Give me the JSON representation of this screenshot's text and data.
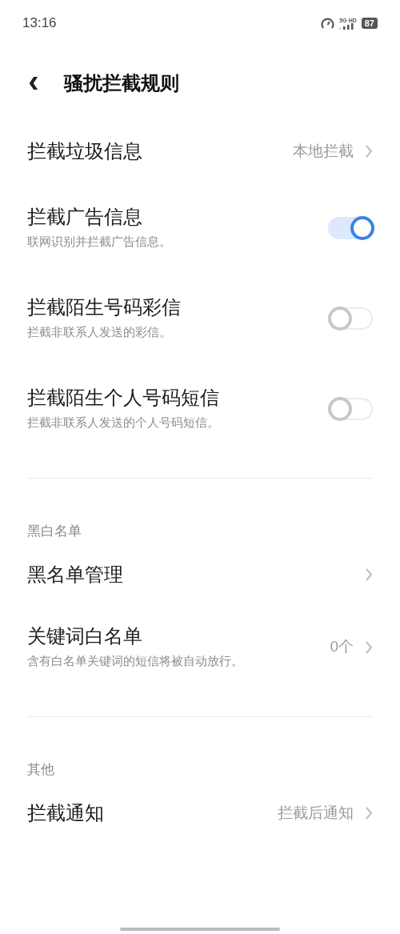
{
  "status_bar": {
    "time": "13:16",
    "network": "5G HD",
    "battery": "87"
  },
  "header": {
    "back": "‹",
    "title": "骚扰拦截规则"
  },
  "sections": [
    {
      "items": [
        {
          "kind": "link",
          "title": "拦截垃圾信息",
          "value": "本地拦截"
        },
        {
          "kind": "toggle",
          "title": "拦截广告信息",
          "subtitle": "联网识别并拦截广告信息。",
          "on": true
        },
        {
          "kind": "toggle",
          "title": "拦截陌生号码彩信",
          "subtitle": "拦截非联系人发送的彩信。",
          "on": false
        },
        {
          "kind": "toggle",
          "title": "拦截陌生个人号码短信",
          "subtitle": "拦截非联系人发送的个人号码短信。",
          "on": false
        }
      ]
    },
    {
      "label": "黑白名单",
      "items": [
        {
          "kind": "link",
          "title": "黑名单管理"
        },
        {
          "kind": "link",
          "title": "关键词白名单",
          "subtitle": "含有白名单关键词的短信将被自动放行。",
          "value": "0个"
        }
      ]
    },
    {
      "label": "其他",
      "items": [
        {
          "kind": "link",
          "title": "拦截通知",
          "value": "拦截后通知"
        }
      ]
    }
  ]
}
